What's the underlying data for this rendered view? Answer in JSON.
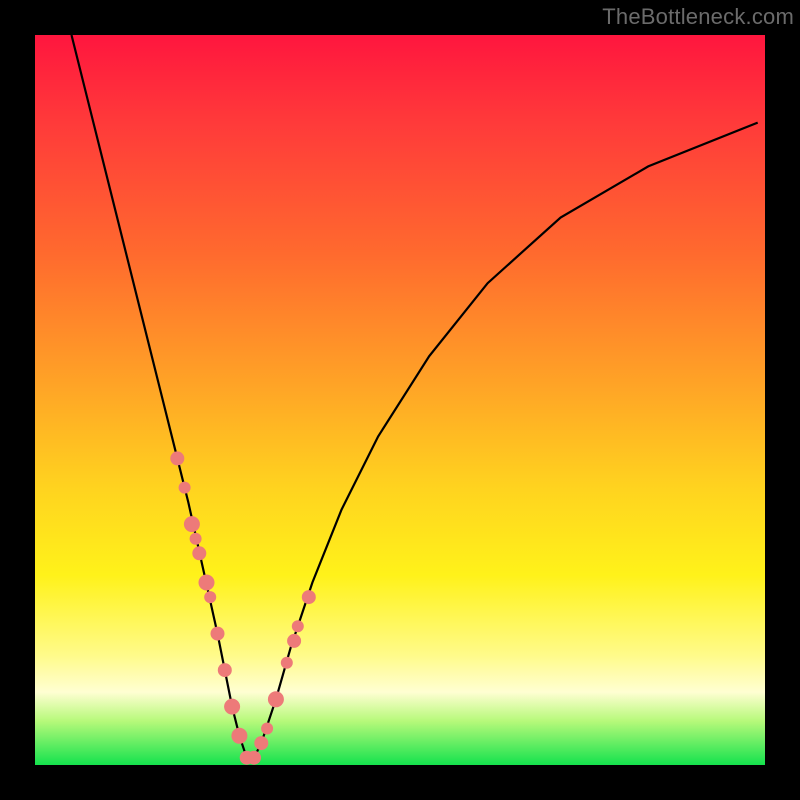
{
  "watermark": "TheBottleneck.com",
  "colors": {
    "frame": "#000000",
    "gradient_top": "#ff163e",
    "gradient_bottom": "#14e24d",
    "curve": "#000000",
    "markers": "#ed7a79"
  },
  "chart_data": {
    "type": "line",
    "title": "",
    "xlabel": "",
    "ylabel": "",
    "xlim": [
      0,
      100
    ],
    "ylim": [
      0,
      100
    ],
    "annotations": [
      "TheBottleneck.com"
    ],
    "series": [
      {
        "name": "bottleneck-curve",
        "x": [
          5,
          8,
          11,
          14,
          17,
          19,
          21,
          23,
          25,
          26,
          27,
          28,
          29,
          30,
          31,
          33,
          35,
          38,
          42,
          47,
          54,
          62,
          72,
          84,
          99
        ],
        "values": [
          100,
          88,
          76,
          64,
          52,
          44,
          36,
          27,
          18,
          13,
          8,
          4,
          1,
          1,
          3,
          9,
          16,
          25,
          35,
          45,
          56,
          66,
          75,
          82,
          88
        ]
      }
    ],
    "markers": {
      "name": "highlighted-points",
      "along_curve": true,
      "x": [
        19.5,
        20.5,
        21.5,
        22.0,
        22.5,
        23.5,
        24.0,
        25.0,
        26.0,
        27.0,
        28.0,
        29.0,
        30.0,
        31.0,
        31.8,
        33.0,
        34.5,
        35.5,
        36.0,
        37.5
      ],
      "values": [
        42,
        38,
        33,
        31,
        29,
        25,
        23,
        18,
        13,
        8,
        4,
        1,
        1,
        3,
        5,
        9,
        14,
        17,
        19,
        23
      ],
      "radius": [
        7,
        6,
        8,
        6,
        7,
        8,
        6,
        7,
        7,
        8,
        8,
        7,
        7,
        7,
        6,
        8,
        6,
        7,
        6,
        7
      ]
    }
  }
}
